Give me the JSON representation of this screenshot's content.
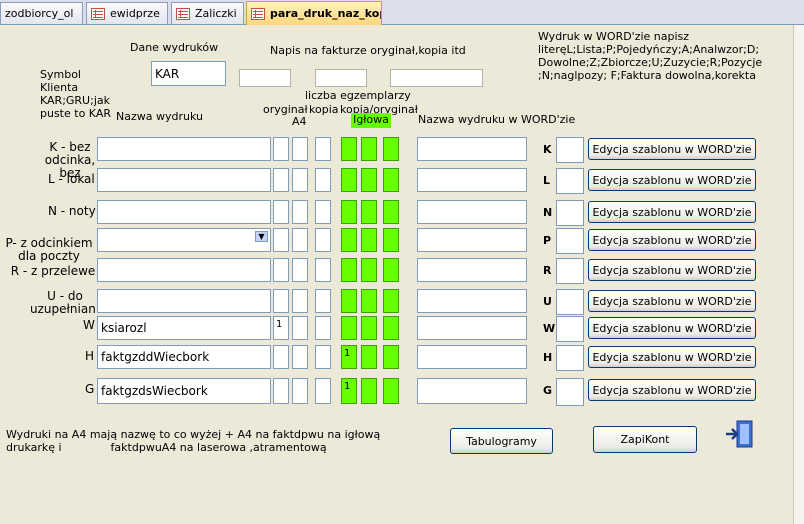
{
  "tabs": [
    {
      "label": "zodbiorcy_ol",
      "active": false
    },
    {
      "label": "ewidprze",
      "active": false
    },
    {
      "label": "Zaliczki",
      "active": false
    },
    {
      "label": "para_druk_naz_kop",
      "active": true
    }
  ],
  "header": {
    "dane_wydrukow": "Dane wydruków",
    "napis_na_fakturze": "Napis na fakturze oryginał,kopia itd",
    "symbol_klienta": "Symbol Klienta KAR;GRU;jak puste to KAR",
    "symbol_value": "KAR",
    "wydruk_info": "Wydruk w WORD'zie napisz literęL;Lista;P;Pojedyńczy;A;Analwzor;D; Dowolne;Z;Zbiorcze;U;Zuzycie;R;Pozycje ;N;naglpozy; F;Faktura dowolna,korekta",
    "liczba_egzemplarzy": "liczba egzemplarzy",
    "oryginal": "oryginał",
    "a4": "A4",
    "kopia": "kopia",
    "kopia_oryginal": "kopia/oryginał",
    "iglowa": "Igłowa",
    "nazwa_wydruku": "Nazwa wydruku",
    "nazwa_wydruku_word": "Nazwa wydruku w WORD'zie"
  },
  "rows": [
    {
      "label": "K  - bez odcinka, bez",
      "name": "",
      "a4": "",
      "iglowa": "",
      "word_letter": "K",
      "button": "Edycja szablonu w WORD'zie"
    },
    {
      "label": "L - lokal",
      "name": "",
      "a4": "",
      "iglowa": "",
      "word_letter": "L",
      "button": "Edycja szablonu w WORD'zie"
    },
    {
      "label": "N - noty",
      "name": "",
      "a4": "",
      "iglowa": "",
      "word_letter": "N",
      "button": "Edycja szablonu w WORD'zie"
    },
    {
      "label": "P- z odcinkiem dla poczty",
      "name": "",
      "a4": "",
      "iglowa": "",
      "word_letter": "P",
      "button": "Edycja szablonu w WORD'zie"
    },
    {
      "label": "R - z przelewe",
      "name": "",
      "a4": "",
      "iglowa": "",
      "word_letter": "R",
      "button": "Edycja szablonu w WORD'zie"
    },
    {
      "label": "U - do uzupełniania",
      "name": "",
      "a4": "",
      "iglowa": "",
      "word_letter": "U",
      "button": "Edycja szablonu w WORD'zie"
    },
    {
      "label": "W",
      "name": "ksiarozl",
      "a4": "1",
      "iglowa": "",
      "word_letter": "W",
      "button": "Edycja szablonu w WORD'zie"
    },
    {
      "label": "H",
      "name": "faktgzddWiecbork",
      "a4": "",
      "iglowa": "1",
      "word_letter": "H",
      "button": "Edycja szablonu w WORD'zie"
    },
    {
      "label": "G",
      "name": "faktgzdsWiecbork",
      "a4": "",
      "iglowa": "1",
      "word_letter": "G",
      "button": "Edycja szablonu w WORD'zie"
    }
  ],
  "footer": {
    "note1": "Wydruki na A4 mają nazwę to co wyżej + A4  na faktdpwu na igłową",
    "note2": "drukarkę i              faktdpwuA4 na laserowa ,atramentową",
    "tabulogramy": "Tabulogramy",
    "zapikont": "ZapiKont",
    "exit_icon": "exit-door-icon"
  },
  "colors": {
    "green": "#66ff00",
    "background": "#ece9d8",
    "active_tab": "#fbd77a"
  }
}
